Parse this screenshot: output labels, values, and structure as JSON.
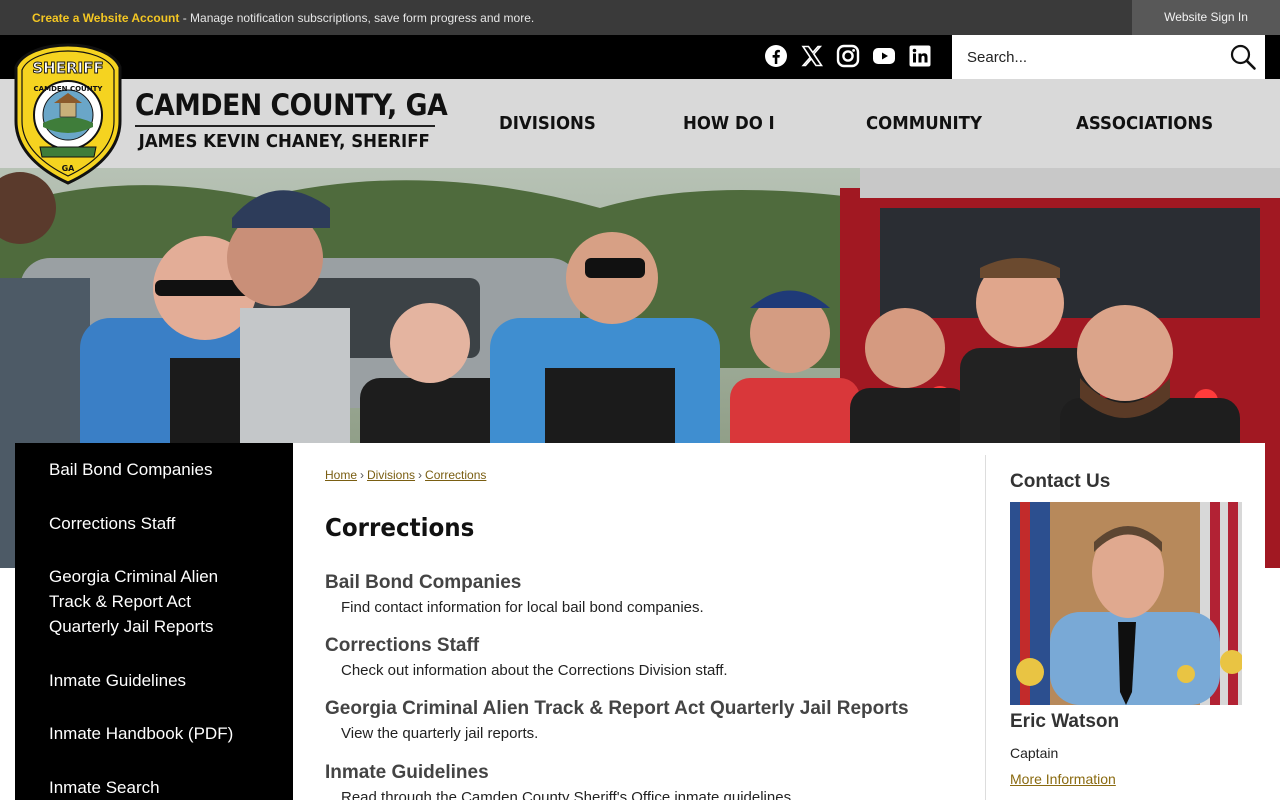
{
  "topbar": {
    "create_account": "Create a Website Account",
    "notice_text": " - Manage notification subscriptions, save form progress and more.",
    "sign_in": "Website Sign In"
  },
  "social": [
    "facebook-icon",
    "x-twitter-icon",
    "instagram-icon",
    "youtube-icon",
    "linkedin-icon"
  ],
  "search": {
    "placeholder": "Search..."
  },
  "brand": {
    "title": "CAMDEN COUNTY, GA",
    "subtitle": "JAMES KEVIN CHANEY, SHERIFF",
    "badge_top": "SHERIFF",
    "badge_ring": "CAMDEN COUNTY",
    "badge_bottom": "GA"
  },
  "nav": {
    "items": [
      "DIVISIONS",
      "HOW DO I",
      "COMMUNITY",
      "ASSOCIATIONS"
    ]
  },
  "sidenav": {
    "items": [
      "Bail Bond Companies",
      "Corrections Staff",
      "Georgia Criminal Alien Track & Report Act Quarterly Jail Reports",
      "Inmate Guidelines",
      "Inmate Handbook (PDF)",
      "Inmate Search"
    ]
  },
  "breadcrumb": {
    "items": [
      "Home",
      "Divisions",
      "Corrections"
    ],
    "separator": "›"
  },
  "page": {
    "title": "Corrections",
    "entries": [
      {
        "heading": "Bail Bond Companies",
        "desc": "Find contact information for local bail bond companies."
      },
      {
        "heading": "Corrections Staff",
        "desc": "Check out information about the Corrections Division staff."
      },
      {
        "heading": "Georgia Criminal Alien Track & Report Act Quarterly Jail Reports",
        "desc": "View the quarterly jail reports."
      },
      {
        "heading": "Inmate Guidelines",
        "desc": "Read through the Camden County Sheriff's Office inmate guidelines."
      }
    ]
  },
  "contact": {
    "heading": "Contact Us",
    "name": "Eric Watson",
    "role": "Captain",
    "more": "More Information"
  },
  "colors": {
    "topbar": "#3a3a3a",
    "accent_gold": "#f3c623",
    "header_gray": "#d9d9d9",
    "link_brown": "#7a5e12"
  }
}
